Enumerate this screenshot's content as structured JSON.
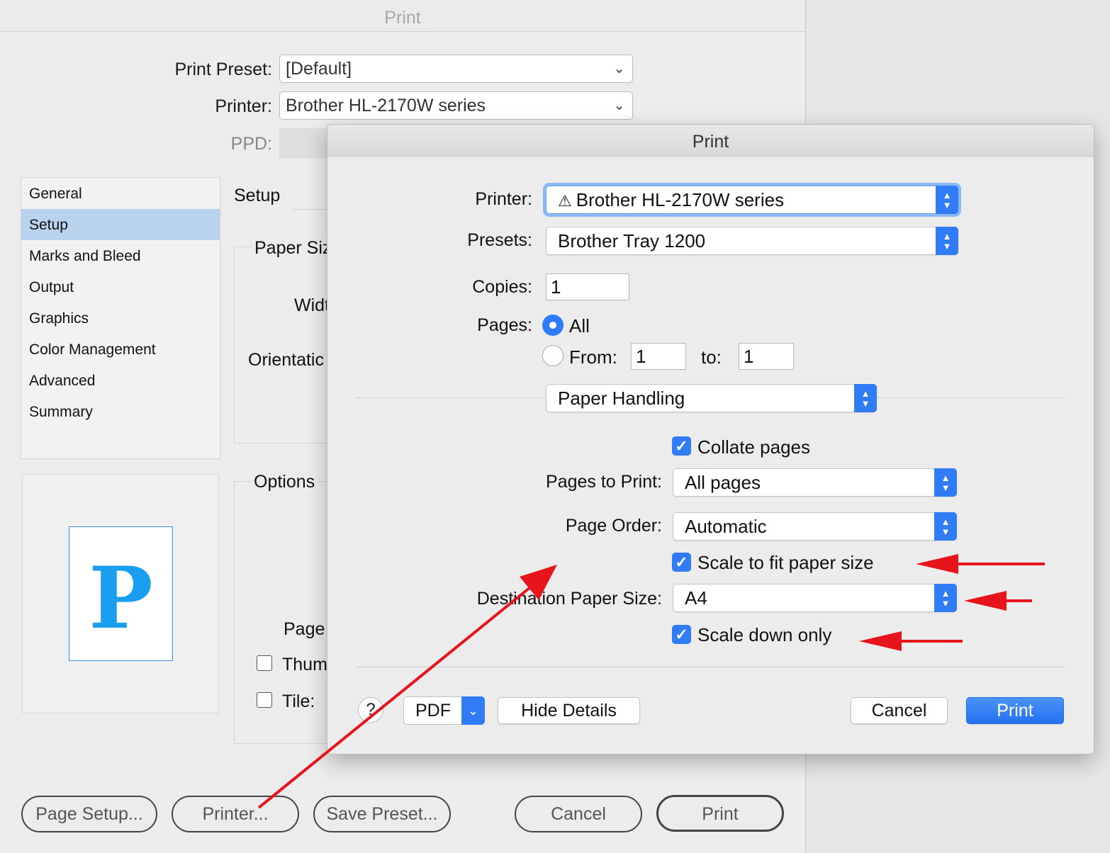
{
  "bg_dialog": {
    "title": "Print",
    "print_preset_label": "Print Preset:",
    "print_preset_value": "[Default]",
    "printer_label": "Printer:",
    "printer_value": "Brother HL-2170W series",
    "ppd_label": "PPD:",
    "sidebar": {
      "items": [
        {
          "label": "General"
        },
        {
          "label": "Setup"
        },
        {
          "label": "Marks and Bleed"
        },
        {
          "label": "Output"
        },
        {
          "label": "Graphics"
        },
        {
          "label": "Color Management"
        },
        {
          "label": "Advanced"
        },
        {
          "label": "Summary"
        }
      ],
      "selected": "Setup"
    },
    "preview_glyph": "P",
    "setup_title": "Setup",
    "paper_size_label": "Paper Siz",
    "width_label": "Widt",
    "orientation_label": "Orientatic",
    "options_label": "Options",
    "page_label": "Page",
    "thumbnails_label": "Thum",
    "tile_label": "Tile:",
    "buttons": {
      "page_setup": "Page Setup...",
      "printer": "Printer...",
      "save_preset": "Save Preset...",
      "cancel": "Cancel",
      "print": "Print"
    }
  },
  "fg_dialog": {
    "title": "Print",
    "printer_label": "Printer:",
    "printer_value": "Brother HL-2170W series",
    "printer_warning_icon": "warning-triangle-icon",
    "presets_label": "Presets:",
    "presets_value": "Brother Tray 1200",
    "copies_label": "Copies:",
    "copies_value": "1",
    "pages_label": "Pages:",
    "pages_all_label": "All",
    "pages_from_label": "From:",
    "pages_from_value": "1",
    "pages_to_label": "to:",
    "pages_to_value": "1",
    "panel_value": "Paper Handling",
    "collate_label": "Collate pages",
    "pages_to_print_label": "Pages to Print:",
    "pages_to_print_value": "All pages",
    "page_order_label": "Page Order:",
    "page_order_value": "Automatic",
    "scale_to_fit_label": "Scale to fit paper size",
    "dest_paper_size_label": "Destination Paper Size:",
    "dest_paper_size_value": "A4",
    "scale_down_only_label": "Scale down only",
    "help_label": "?",
    "pdf_label": "PDF",
    "hide_details_label": "Hide Details",
    "cancel_label": "Cancel",
    "print_label": "Print",
    "accent_color": "#2f7cf6"
  },
  "annotations": {
    "arrow_color": "#e8141b"
  }
}
